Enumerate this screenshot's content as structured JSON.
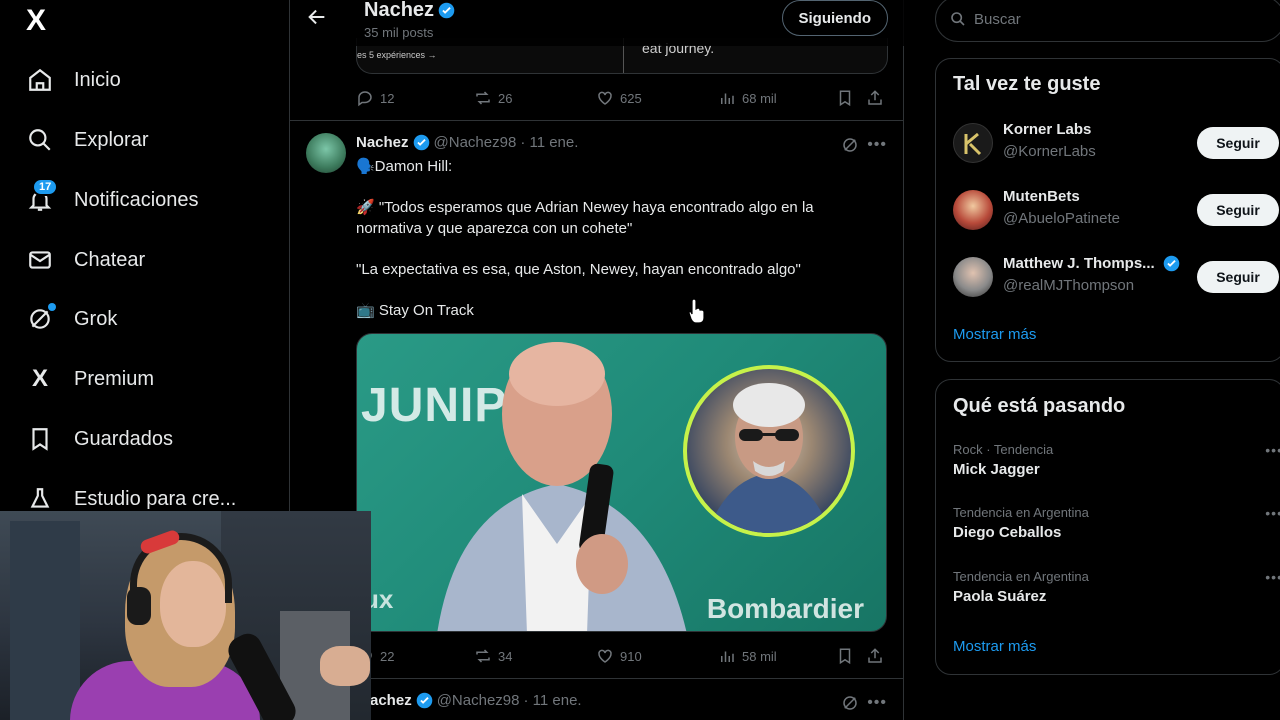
{
  "nav": {
    "logo": "X",
    "items": [
      {
        "label": "Inicio"
      },
      {
        "label": "Explorar"
      },
      {
        "label": "Notificaciones",
        "badge": "17"
      },
      {
        "label": "Chatear"
      },
      {
        "label": "Grok"
      },
      {
        "label": "Premium"
      },
      {
        "label": "Guardados"
      },
      {
        "label": "Estudio para cre..."
      }
    ]
  },
  "header": {
    "name": "Nachez",
    "posts": "35 mil posts",
    "follow_label": "Siguiendo"
  },
  "prev_post": {
    "card_left": "es 5 expériences →",
    "card_right": "eat journey.",
    "replies": "12",
    "reposts": "26",
    "likes": "625",
    "views": "68 mil"
  },
  "post": {
    "name": "Nachez",
    "handle": "@Nachez98",
    "date": "· 11 ene.",
    "line1": "🗣️Damon Hill:",
    "line2": "🚀 \"Todos esperamos que Adrian Newey haya encontrado algo en la normativa y que aparezca con un cohete\"",
    "line3": "\"La expectativa es esa, que Aston, Newey, hayan encontrado algo\"",
    "line4": "📺 Stay On Track",
    "media": {
      "brand_left": "JUNIPE",
      "brand_right": "Bombardier",
      "aux": "ux"
    },
    "replies": "22",
    "reposts": "34",
    "likes": "910",
    "views": "58 mil"
  },
  "next_post": {
    "name": "achez",
    "handle": "@Nachez98",
    "date": "· 11 ene."
  },
  "sidebar": {
    "search_placeholder": "Buscar",
    "who_title": "Tal vez te guste",
    "who": [
      {
        "name": "Korner Labs",
        "handle": "@KornerLabs",
        "button": "Seguir",
        "verified": false
      },
      {
        "name": "MutenBets",
        "handle": "@AbueloPatinete",
        "button": "Seguir",
        "verified": false
      },
      {
        "name": "Matthew J. Thomps...",
        "handle": "@realMJThompson",
        "button": "Seguir",
        "verified": true
      }
    ],
    "who_more": "Mostrar más",
    "trends_title": "Qué está pasando",
    "trends": [
      {
        "context": "Rock · Tendencia",
        "title": "Mick Jagger"
      },
      {
        "context": "Tendencia en Argentina",
        "title": "Diego Ceballos"
      },
      {
        "context": "Tendencia en Argentina",
        "title": "Paola Suárez"
      }
    ],
    "trends_more": "Mostrar más"
  },
  "colors": {
    "accent": "#1d9bf0",
    "background": "#000000",
    "border": "#2f3336",
    "muted": "#71767b"
  }
}
